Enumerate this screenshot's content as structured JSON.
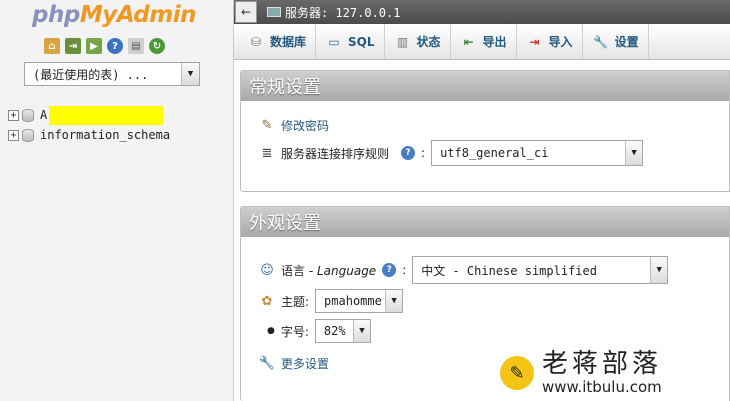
{
  "nav": {
    "logo_php": "php",
    "logo_my": "My",
    "logo_admin": "Admin",
    "quick_icons": [
      "home-icon",
      "logout-icon",
      "query-window-icon",
      "docs-icon",
      "sql-docs-icon",
      "reload-icon"
    ],
    "recent_select": "(最近使用的表) ...",
    "tree": [
      {
        "label": "A",
        "highlighted": true
      },
      {
        "label": "information_schema",
        "highlighted": false
      }
    ]
  },
  "topbar": {
    "collapse_glyph": "←",
    "server_label": "服务器: 127.0.0.1"
  },
  "tabs": [
    {
      "label": "数据库",
      "icon": "database-icon"
    },
    {
      "label": "SQL",
      "icon": "sql-icon"
    },
    {
      "label": "状态",
      "icon": "status-icon"
    },
    {
      "label": "导出",
      "icon": "export-icon"
    },
    {
      "label": "导入",
      "icon": "import-icon"
    },
    {
      "label": "设置",
      "icon": "settings-icon"
    }
  ],
  "general": {
    "title": "常规设置",
    "change_password": "修改密码",
    "collation_label": "服务器连接排序规则",
    "colon": ":",
    "collation_value": "utf8_general_ci"
  },
  "appearance": {
    "title": "外观设置",
    "language_label": "语言 - ",
    "language_label_en": "Language",
    "language_value": "中文 - Chinese simplified",
    "theme_label": "主题:",
    "theme_value": "pmahomme",
    "font_label": "字号:",
    "font_value": "82%",
    "more_settings": "更多设置"
  },
  "watermark": {
    "title": "老蒋部落",
    "url": "www.itbulu.com"
  },
  "colors": {
    "link": "#235a81",
    "logo_php": "#8892bf",
    "logo_myadmin": "#f29722",
    "highlight": "#ffff00"
  }
}
